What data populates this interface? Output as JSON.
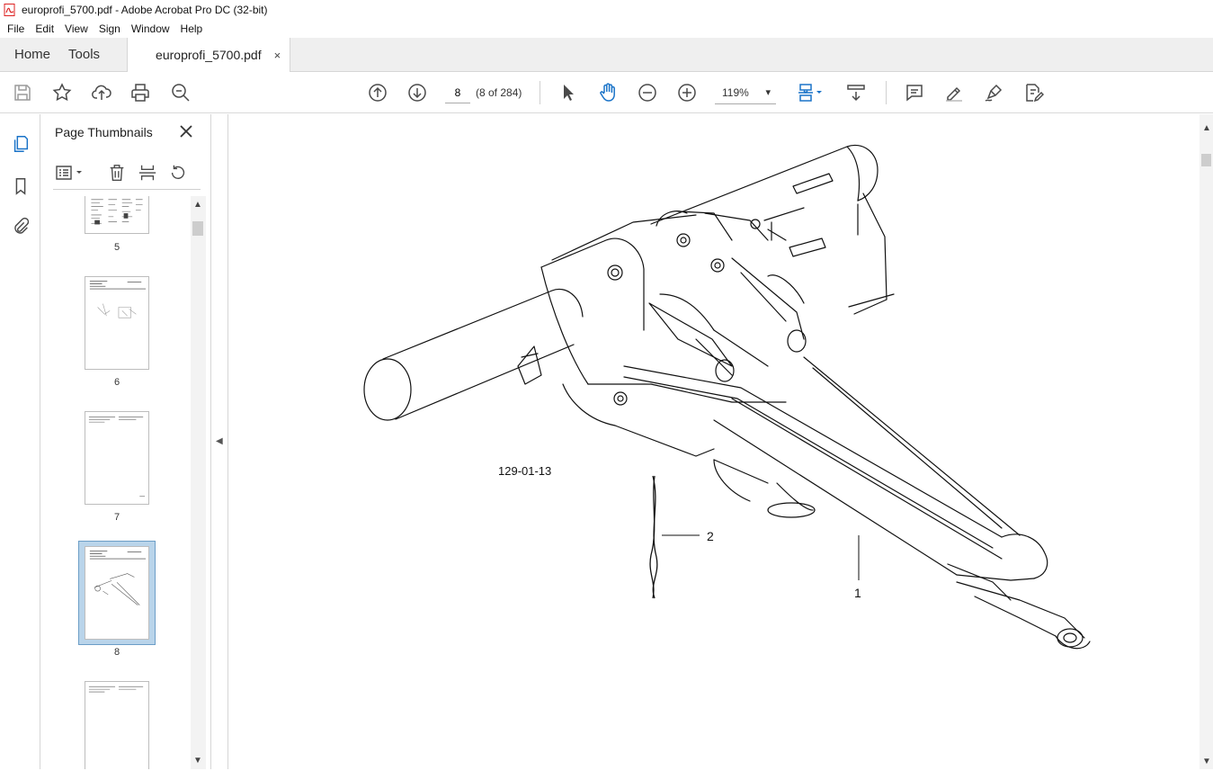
{
  "window": {
    "title": "europrofi_5700.pdf - Adobe Acrobat Pro DC (32-bit)"
  },
  "menu": [
    "File",
    "Edit",
    "View",
    "Sign",
    "Window",
    "Help"
  ],
  "tabs": {
    "home": "Home",
    "tools": "Tools",
    "document": "europrofi_5700.pdf",
    "close": "×"
  },
  "toolbar": {
    "page_number": "8",
    "page_count": "(8 of 284)",
    "zoom": "119%",
    "zoom_caret": "▾"
  },
  "thumbnails": {
    "title": "Page Thumbnails",
    "pages": [
      {
        "label": "5"
      },
      {
        "label": "6"
      },
      {
        "label": "7"
      },
      {
        "label": "8"
      },
      {
        "label": ""
      }
    ],
    "selected": "8"
  },
  "document": {
    "figure_ref": "129-01-13",
    "callouts": [
      "1",
      "2"
    ]
  },
  "colors": {
    "accent": "#1a73c8",
    "selection": "#b9d4ea",
    "icon": "#4a4a4a"
  }
}
